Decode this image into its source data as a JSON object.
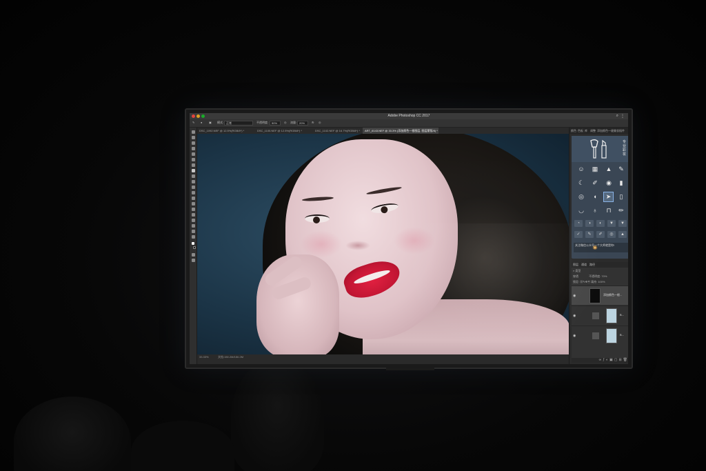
{
  "window": {
    "app_title": "Adobe Photoshop CC 2017",
    "search_icon": "search-icon",
    "menu_icon": "kebab-icon"
  },
  "options_bar": {
    "mode_label": "模式:",
    "mode_value": "正常",
    "opacity_label": "不透明度:",
    "opacity_value": "50%",
    "flow_label": "流量:",
    "flow_value": "20%"
  },
  "document_tabs": [
    {
      "label": "DSC_1092.NEF @ 12.5%(RGB/8*) *",
      "active": false
    },
    {
      "label": "DSC_1100.NEF @ 12.5%(RGB/8*) *",
      "active": false
    },
    {
      "label": "DSC_1102.NEF @ 16.7%(RGB/8*) *",
      "active": false
    },
    {
      "label": "ART_6143.NEF @ 33.3% (添加颜色一根图层, 图层蒙版/8) *",
      "active": true
    }
  ],
  "status_bar": {
    "zoom": "33.33%",
    "doc_info": "文档:150.2M/150.2M"
  },
  "panel": {
    "tabs": [
      "颜色",
      "色板",
      "库",
      "调整",
      "添加颜色一键美妆插件"
    ],
    "plugin_title": "专业彩妆",
    "plugin_note": "关注微信公众号一个大师就是你!",
    "selected_tool": "blush-icon"
  },
  "layers_panel": {
    "tabs": [
      "图层",
      "通道",
      "路径"
    ],
    "kind_label": "类型",
    "blend_mode": "穿透",
    "opacity_label": "不透明度:",
    "opacity_value": "70%",
    "lock_label": "锁定:",
    "fill_label": "填充:",
    "fill_value": "100%",
    "layers": [
      {
        "name": "添加颜色一根...",
        "active": true,
        "thumb_color": "#0c0c0c"
      },
      {
        "name": "B...",
        "active": false,
        "thumb_color": "#bcd4e0"
      },
      {
        "name": "B...",
        "active": false,
        "thumb_color": "#bcd4e0"
      }
    ]
  }
}
